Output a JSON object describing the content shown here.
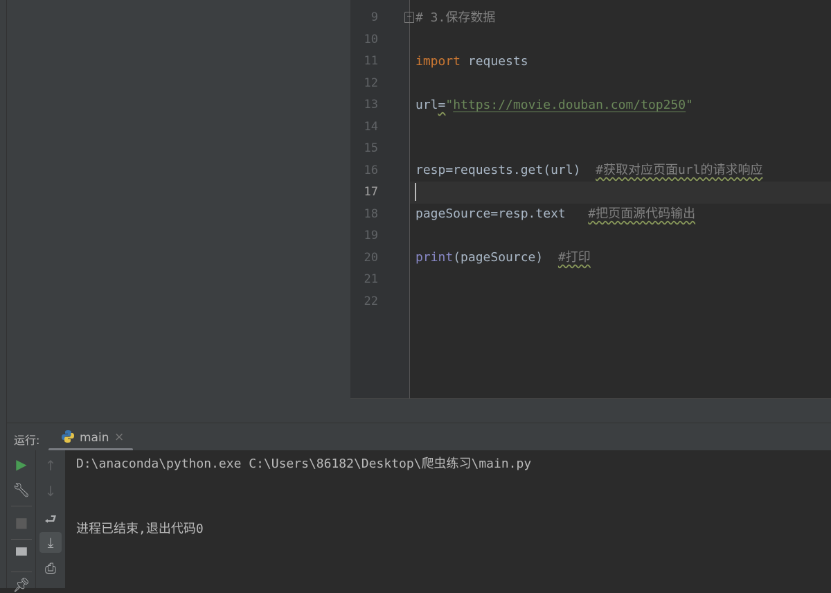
{
  "editor": {
    "line_numbers": [
      "9",
      "10",
      "11",
      "12",
      "13",
      "14",
      "15",
      "16",
      "17",
      "18",
      "19",
      "20",
      "21",
      "22"
    ],
    "current_line": "17",
    "comment9": "# 3.保存数据",
    "l11_kw": "import",
    "l11_rest": " requests",
    "l13_var": "url",
    "l13_eq": "=",
    "l13_str_q": "\"",
    "l13_url": "https://movie.douban.com/top250",
    "l13_str_q2": "\"",
    "l16_code": "resp=requests.get(url)",
    "l16_comment": "#获取对应页面url的请求响应",
    "l18_code": "pageSource=resp.text",
    "l18_comment": "#把页面源代码输出",
    "l20_fn": "print",
    "l20_rest": "(pageSource)",
    "l20_comment": "#打印"
  },
  "run": {
    "label": "运行:",
    "tab": "main",
    "close": "×",
    "command": "D:\\anaconda\\python.exe C:\\Users\\86182\\Desktop\\爬虫练习\\main.py",
    "exit_message": "进程已结束,退出代码0"
  },
  "colors": {
    "run": "#499c54",
    "keyword": "#cc7832",
    "string": "#6a8759",
    "comment": "#808080"
  }
}
